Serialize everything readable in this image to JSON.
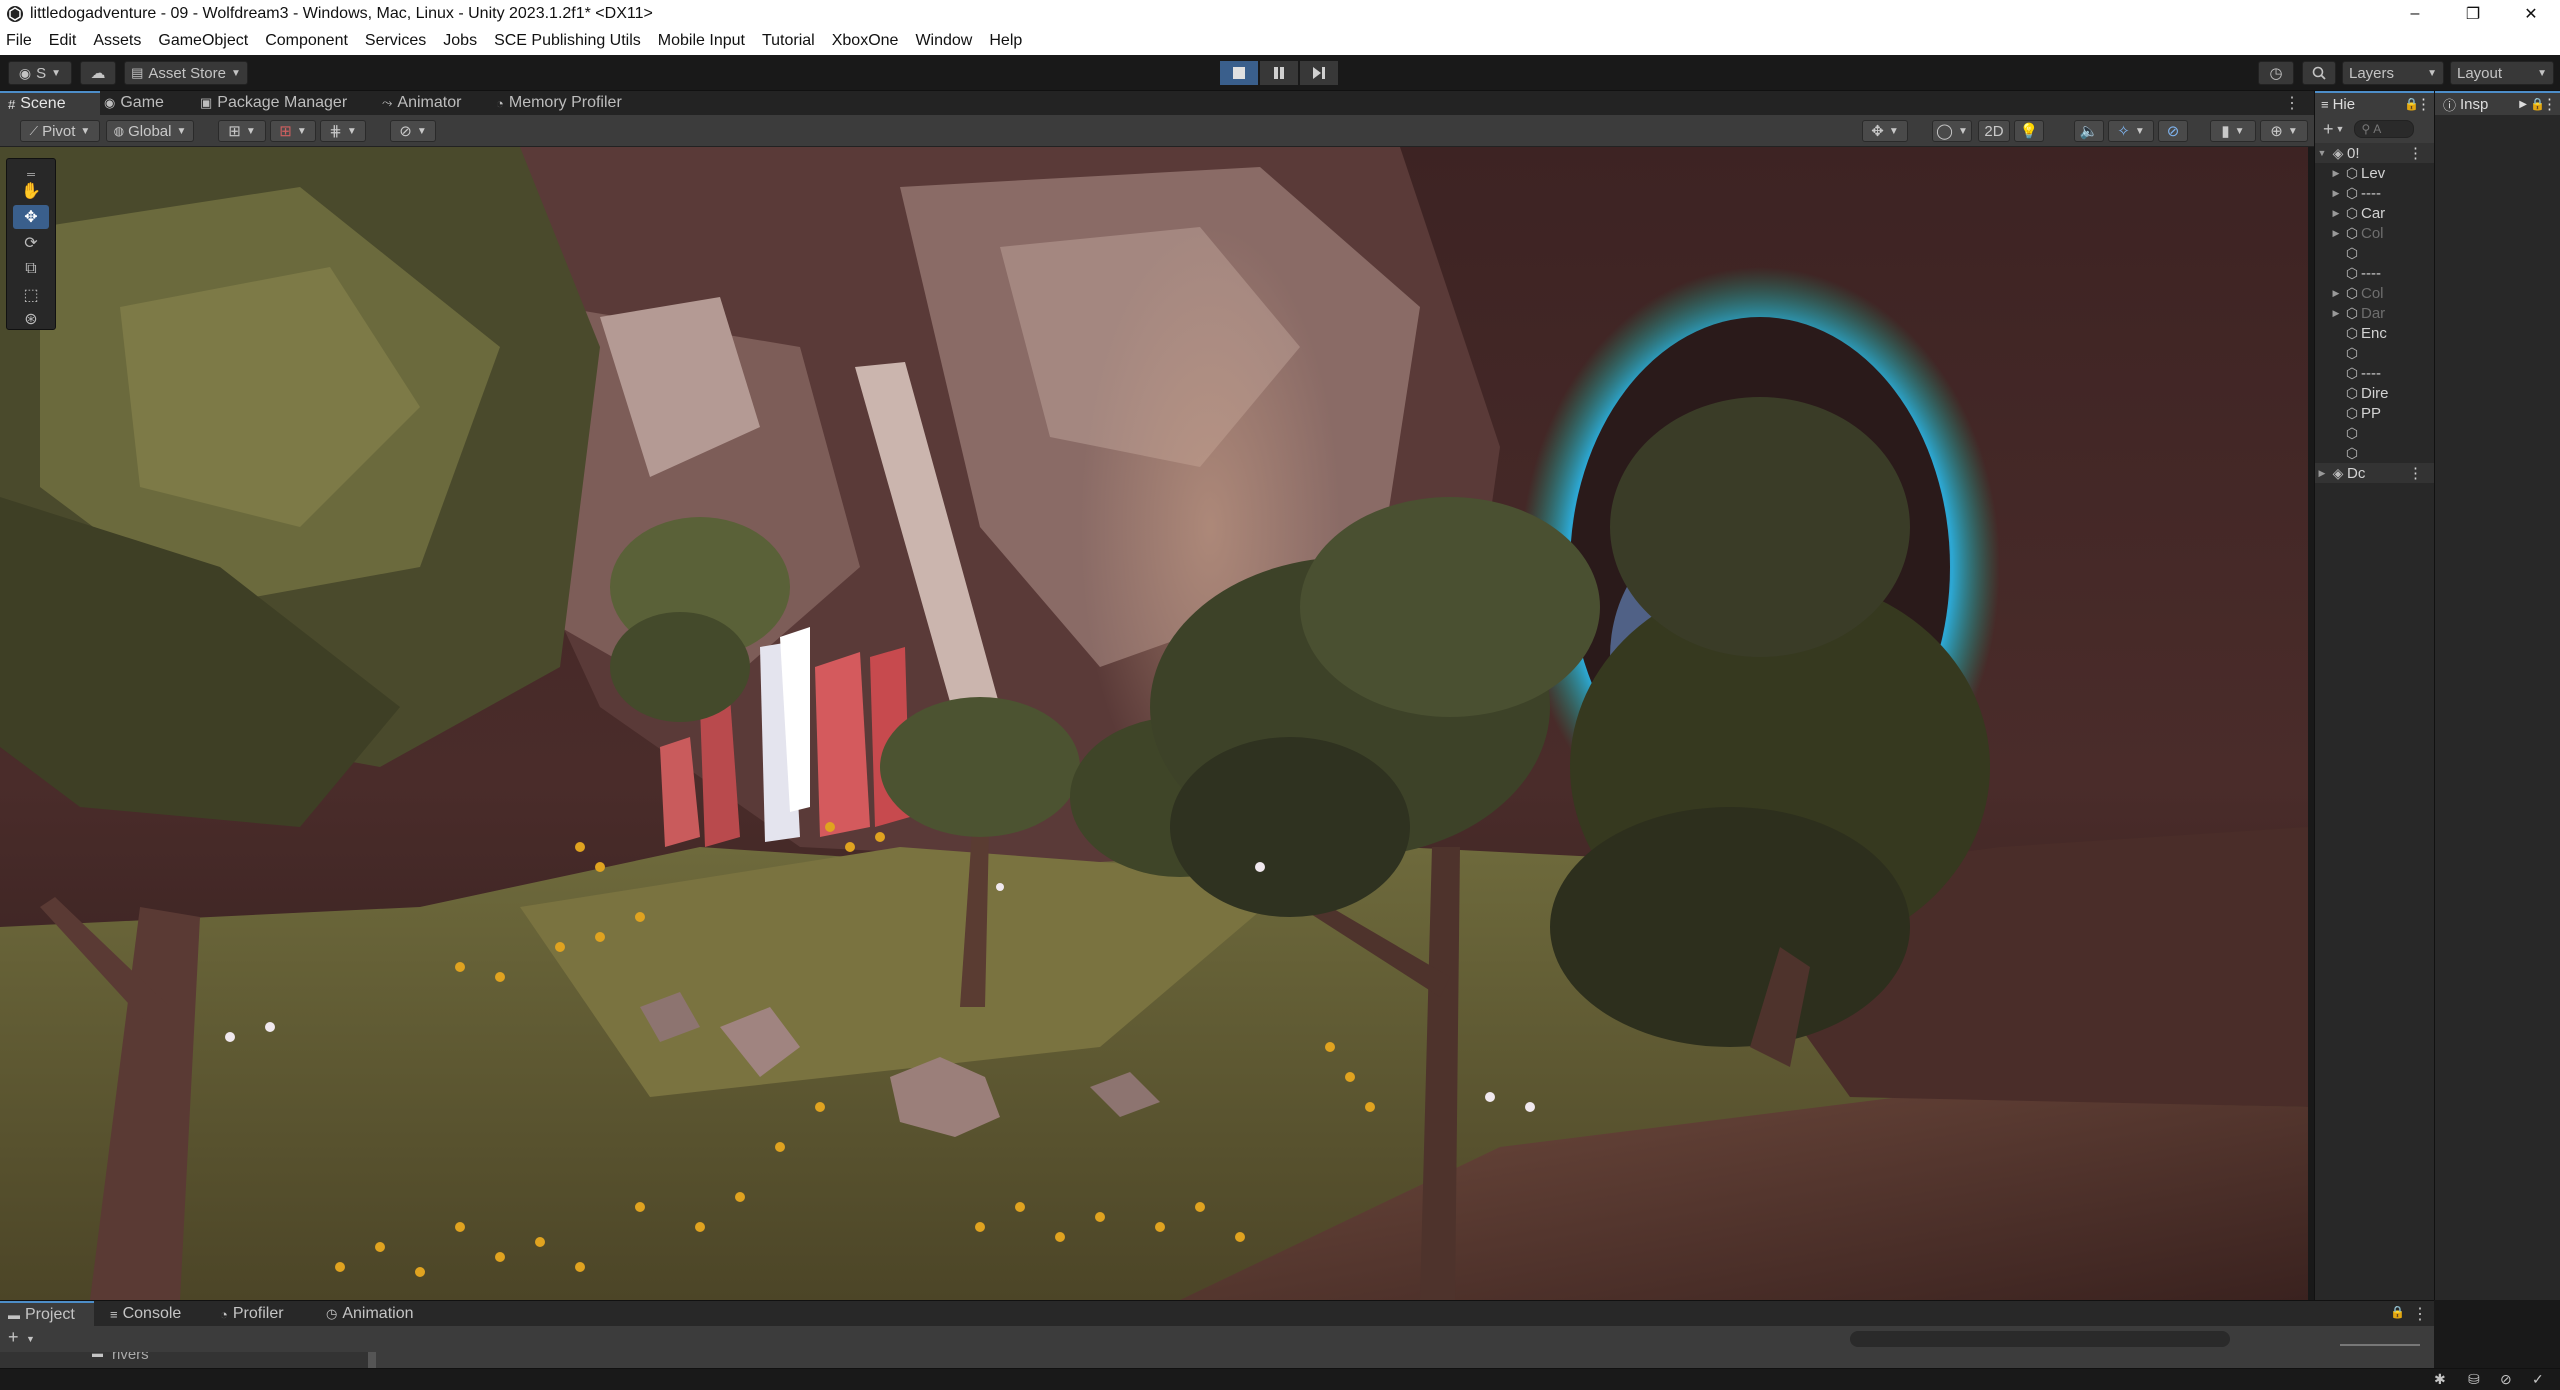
{
  "window": {
    "title": "littledogadventure - 09 - Wolfdream3 - Windows, Mac, Linux - Unity 2023.1.2f1* <DX11>",
    "minimize": "–",
    "maximize": "❐",
    "close": "✕"
  },
  "menu": [
    "File",
    "Edit",
    "Assets",
    "GameObject",
    "Component",
    "Services",
    "Jobs",
    "SCE Publishing Utils",
    "Mobile Input",
    "Tutorial",
    "XboxOne",
    "Window",
    "Help"
  ],
  "toolbar": {
    "account_label": "S",
    "asset_store_label": "Asset Store",
    "layers_label": "Layers",
    "layout_label": "Layout"
  },
  "scene_tabs": [
    {
      "label": "Scene",
      "icon": "grid-icon",
      "glyph": "#"
    },
    {
      "label": "Game",
      "icon": "gamepad-icon",
      "glyph": "◉"
    },
    {
      "label": "Package Manager",
      "icon": "package-icon",
      "glyph": "▣"
    },
    {
      "label": "Animator",
      "icon": "animator-icon",
      "glyph": "⤳"
    },
    {
      "label": "Memory Profiler",
      "icon": "memory-icon",
      "glyph": "◔"
    }
  ],
  "scene_toolbar": {
    "pivot_label": "Pivot",
    "global_label": "Global",
    "mode_2d_label": "2D"
  },
  "hierarchy": {
    "tab_label": "Hie",
    "search_placeholder": "A",
    "scene_name": "0!",
    "rows": [
      {
        "label": "Lev",
        "arrow": "▶",
        "dim": false
      },
      {
        "label": "----",
        "arrow": "▶",
        "dim": false
      },
      {
        "label": "Car",
        "arrow": "▶",
        "dim": false
      },
      {
        "label": "Col",
        "arrow": "▶",
        "dim": true
      },
      {
        "label": "",
        "arrow": "",
        "dim": false
      },
      {
        "label": "----",
        "arrow": "",
        "dim": false
      },
      {
        "label": "Col",
        "arrow": "▶",
        "dim": true
      },
      {
        "label": "Dar",
        "arrow": "▶",
        "dim": true
      },
      {
        "label": "Enc",
        "arrow": "",
        "dim": false
      },
      {
        "label": "",
        "arrow": "",
        "dim": false
      },
      {
        "label": "----",
        "arrow": "",
        "dim": false
      },
      {
        "label": "Dire",
        "arrow": "",
        "dim": false
      },
      {
        "label": "PP",
        "arrow": "",
        "dim": false
      },
      {
        "label": "",
        "arrow": "",
        "dim": false
      },
      {
        "label": "",
        "arrow": "",
        "dim": false
      }
    ],
    "dont_destroy_label": "Dc"
  },
  "inspector": {
    "tab_label": "Insp"
  },
  "bottom_tabs": [
    {
      "label": "Project",
      "glyph": "▬"
    },
    {
      "label": "Console",
      "glyph": "≡"
    },
    {
      "label": "Profiler",
      "glyph": "◔"
    },
    {
      "label": "Animation",
      "glyph": "◷"
    }
  ],
  "project": {
    "folder_partial": "rivers"
  },
  "colors": {
    "accent": "#4d8ec9",
    "active_button": "#3a5f8c"
  }
}
